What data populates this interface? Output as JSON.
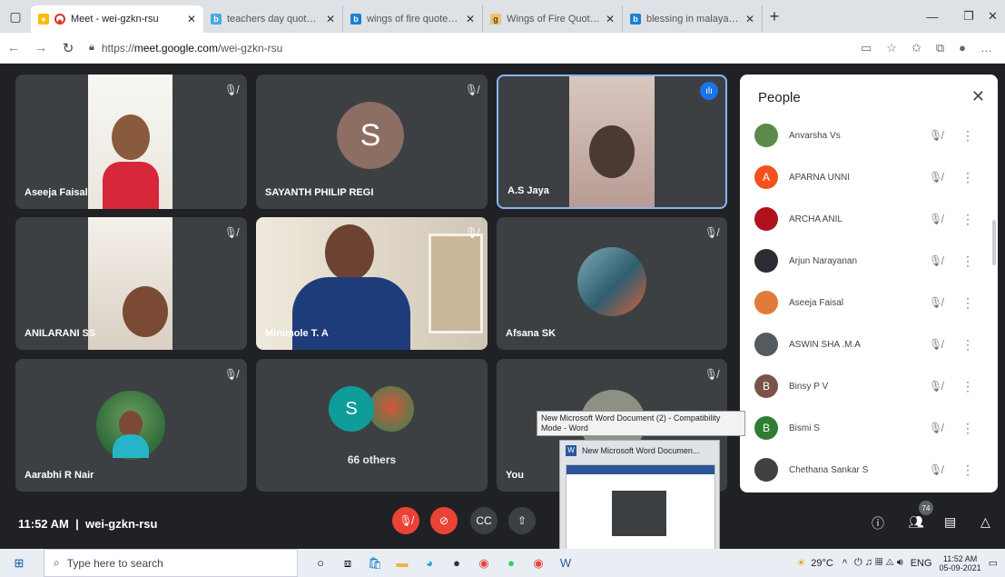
{
  "browser": {
    "tabs": [
      {
        "title": "Meet - wei-gzkn-rsu",
        "active": true,
        "fav": "G"
      },
      {
        "title": "teachers day quotes - Bing",
        "active": false,
        "fav": "b"
      },
      {
        "title": "wings of fire quotes - Bing",
        "active": false,
        "fav": "b"
      },
      {
        "title": "Wings of Fire Quotes by A.P.J",
        "active": false,
        "fav": "g"
      },
      {
        "title": "blessing in malayalam - Bing",
        "active": false,
        "fav": "b"
      }
    ],
    "url_prefix": "https://",
    "url_host": "meet.google.com",
    "url_path": "/wei-gzkn-rsu"
  },
  "tiles": {
    "aseeja": "Aseeja Faisal",
    "sayanth": "SAYANTH PHILIP REGI",
    "sayanth_initial": "S",
    "jaya": "A.S Jaya",
    "anilarani": "ANILARANI SS",
    "minimole": "Minimole T. A",
    "afsana": "Afsana SK",
    "aarabhi": "Aarabhi R Nair",
    "others_initial": "S",
    "others": "66 others",
    "you": "You"
  },
  "people": {
    "title": "People",
    "list": [
      {
        "name": "Anvarsha Vs",
        "initial": "",
        "color": "#5b8a4a"
      },
      {
        "name": "APARNA UNNI",
        "initial": "A",
        "color": "#f4511e"
      },
      {
        "name": "ARCHA ANIL",
        "initial": "",
        "color": "#b0121d"
      },
      {
        "name": "Arjun Narayanan",
        "initial": "",
        "color": "#2c2c34"
      },
      {
        "name": "Aseeja Faisal",
        "initial": "",
        "color": "#e07b39"
      },
      {
        "name": "ASWIN SHA .M.A",
        "initial": "",
        "color": "#555a60"
      },
      {
        "name": "Binsy P V",
        "initial": "B",
        "color": "#795548"
      },
      {
        "name": "Bismi S",
        "initial": "B",
        "color": "#2e7d32"
      },
      {
        "name": "Chethana Sankar S",
        "initial": "",
        "color": "#404040"
      }
    ]
  },
  "meeting": {
    "time": "11:52 AM",
    "code": "wei-gzkn-rsu",
    "participant_count": "74"
  },
  "tooltip": {
    "text": "New Microsoft Word Document (2)  -  Compatibility Mode - Word"
  },
  "preview": {
    "title": "New Microsoft Word Documen..."
  },
  "taskbar": {
    "search_placeholder": "Type here to search",
    "temp": "29°C",
    "lang": "ENG",
    "time": "11:52 AM",
    "date": "05-09-2021"
  }
}
